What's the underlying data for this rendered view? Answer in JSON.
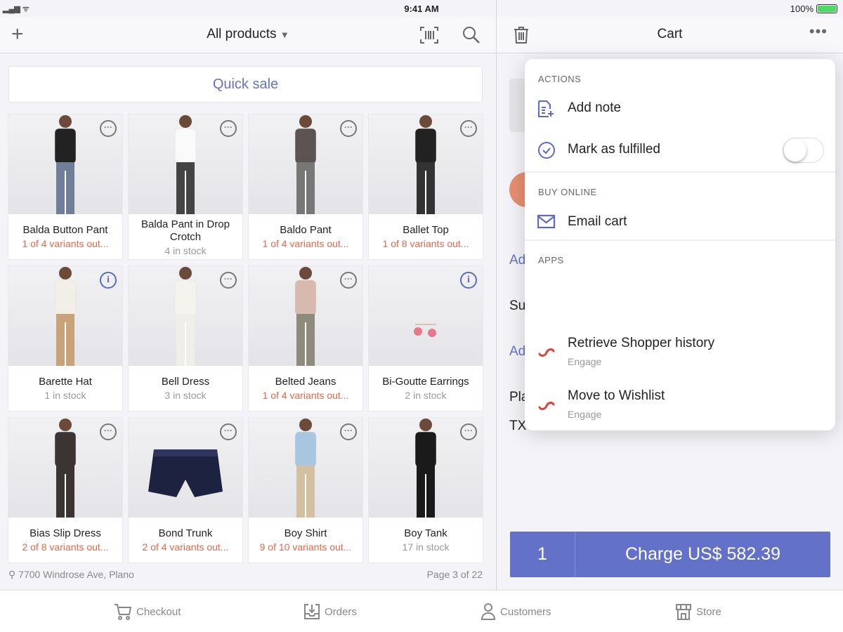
{
  "status_bar": {
    "time": "9:41 AM",
    "battery": "100%",
    "battery_level": 1.0
  },
  "products_header": {
    "title": "All products",
    "icons": [
      "plus-icon",
      "barcode-icon",
      "search-icon"
    ]
  },
  "quick_sale": "Quick sale",
  "products": [
    {
      "name": "Balda Button Pant",
      "stock": "1 of 4 variants out...",
      "warn": true,
      "badge": "more",
      "top": "#222",
      "bottom": "#6f7f9a"
    },
    {
      "name": "Balda Pant in Drop Crotch",
      "stock": "4 in stock",
      "warn": false,
      "badge": "more",
      "top": "#fafafa",
      "bottom": "#444"
    },
    {
      "name": "Baldo Pant",
      "stock": "1 of 4 variants out...",
      "warn": true,
      "badge": "more",
      "top": "#5b5452",
      "bottom": "#777"
    },
    {
      "name": "Ballet Top",
      "stock": "1 of 8 variants out...",
      "warn": true,
      "badge": "more",
      "top": "#222",
      "bottom": "#333"
    },
    {
      "name": "Barette Hat",
      "stock": "1 in stock",
      "warn": false,
      "badge": "info",
      "top": "#f2efe6",
      "bottom": "#c9a27a"
    },
    {
      "name": "Bell Dress",
      "stock": "3 in stock",
      "warn": false,
      "badge": "more",
      "top": "#f4f3ee",
      "bottom": "#f0eee8"
    },
    {
      "name": "Belted Jeans",
      "stock": "1 of 4 variants out...",
      "warn": true,
      "badge": "more",
      "top": "#d8b9ae",
      "bottom": "#8f8a7e"
    },
    {
      "name": "Bi-Goutte Earrings",
      "stock": "2 in stock",
      "warn": false,
      "badge": "info",
      "top": "#e7778b",
      "bottom": "#e7778b"
    },
    {
      "name": "Bias Slip Dress",
      "stock": "2 of 8 variants out...",
      "warn": true,
      "badge": "more",
      "top": "#3b3433",
      "bottom": "#3b3433"
    },
    {
      "name": "Bond Trunk",
      "stock": "2 of 4 variants out...",
      "warn": true,
      "badge": "more",
      "top": "#1d2240",
      "bottom": "#1d2240"
    },
    {
      "name": "Boy Shirt",
      "stock": "9 of 10 variants out...",
      "warn": true,
      "badge": "more",
      "top": "#a8c6e0",
      "bottom": "#d4bfa0"
    },
    {
      "name": "Boy Tank",
      "stock": "17 in stock",
      "warn": false,
      "badge": "more",
      "top": "#1a1a1a",
      "bottom": "#1a1a1a"
    }
  ],
  "footer": {
    "location": "7700 Windrose Ave, Plano",
    "page": "Page 3 of 22"
  },
  "cart": {
    "title": "Cart",
    "background_fragments": [
      "Ad",
      "Su",
      "Ad",
      "Pla",
      "TX"
    ],
    "quantity": "1",
    "charge_label": "Charge US$ 582.39"
  },
  "menu": {
    "actions_header": "ACTIONS",
    "add_note": "Add note",
    "mark_fulfilled": "Mark as fulfilled",
    "mark_fulfilled_on": false,
    "buy_online_header": "BUY ONLINE",
    "email_cart": "Email cart",
    "apps_header": "APPS",
    "apps": [
      {
        "label": "Retrieve Shopper history",
        "sub": "Engage"
      },
      {
        "label": "Move to Wishlist",
        "sub": "Engage"
      }
    ]
  },
  "tabs": [
    {
      "label": "Checkout",
      "icon": "cart-icon"
    },
    {
      "label": "Orders",
      "icon": "orders-icon"
    },
    {
      "label": "Customers",
      "icon": "person-icon"
    },
    {
      "label": "Store",
      "icon": "store-icon"
    }
  ],
  "colors": {
    "accent": "#6371c9",
    "warning": "#e2674b",
    "engage": "#e0403a"
  }
}
